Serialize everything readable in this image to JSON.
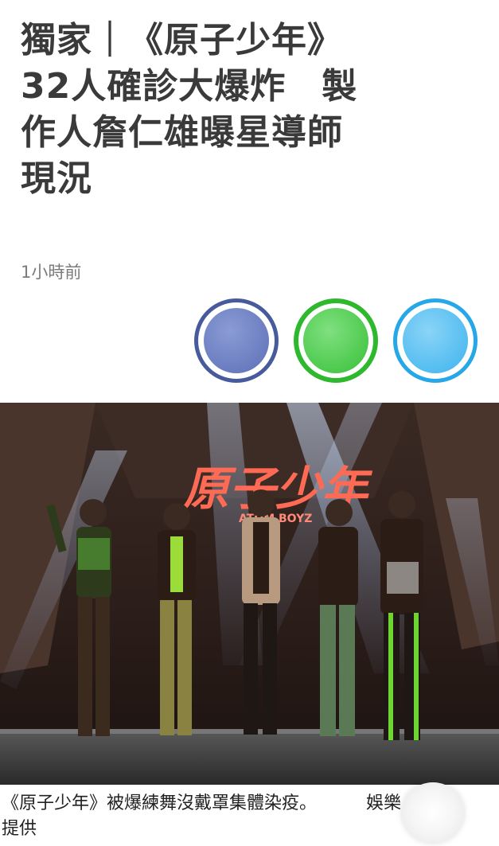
{
  "article": {
    "headline": "獨家｜《原子少年》\n32人確診大爆炸　製\n作人詹仁雄曝星導師\n現況",
    "timestamp": "1小時前"
  },
  "share": {
    "buttons": [
      "facebook",
      "line",
      "twitter"
    ],
    "colors": {
      "facebook": "#475a9c",
      "line": "#2eb82e",
      "twitter": "#26a7e8"
    }
  },
  "photo": {
    "stage_logo_text": "原子少年",
    "stage_logo_sub": "ATOM BOYZ"
  },
  "caption": {
    "line1": "《原子少年》被爆練舞沒戴罩集體染疫。",
    "line1_tail": "娛樂",
    "line2": "提供"
  }
}
